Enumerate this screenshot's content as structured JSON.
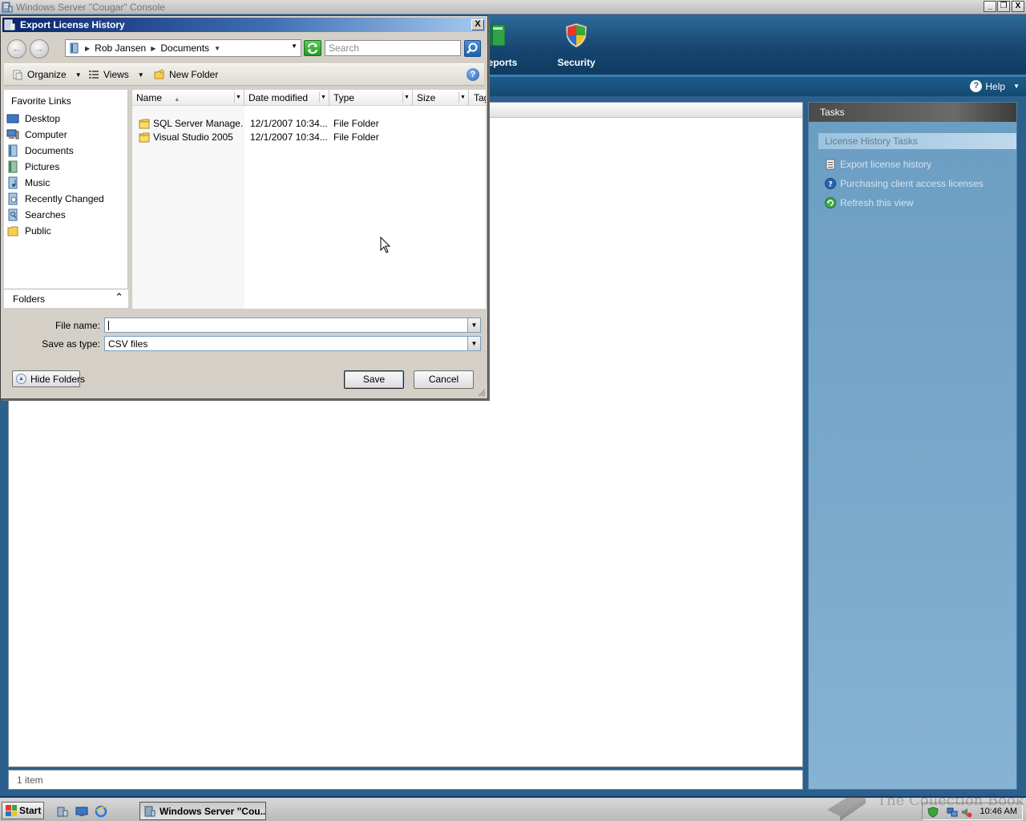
{
  "console": {
    "title": "Windows Server \"Cougar\" Console",
    "nav_tabs": [
      {
        "label": "eports",
        "icon": "reports-book-icon"
      },
      {
        "label": "Security",
        "icon": "security-shield-icon"
      }
    ],
    "help_label": "Help",
    "status_text": "1 item",
    "tasks": {
      "header": "Tasks",
      "section_title": "License History Tasks",
      "links": [
        {
          "label": "Export license history",
          "icon": "document-list-icon"
        },
        {
          "label": "Purchasing client access licenses",
          "icon": "help-circle-icon"
        },
        {
          "label": "Refresh this view",
          "icon": "refresh-icon"
        }
      ]
    }
  },
  "dialog": {
    "title": "Export License History",
    "close_glyph": "X",
    "breadcrumbs": [
      "Rob Jansen",
      "Documents"
    ],
    "search_placeholder": "Search",
    "toolbar": {
      "organize": "Organize",
      "views": "Views",
      "new_folder": "New Folder"
    },
    "favorites": {
      "title": "Favorite Links",
      "items": [
        {
          "label": "Desktop",
          "icon": "desktop-icon"
        },
        {
          "label": "Computer",
          "icon": "computer-icon"
        },
        {
          "label": "Documents",
          "icon": "documents-icon"
        },
        {
          "label": "Pictures",
          "icon": "pictures-icon"
        },
        {
          "label": "Music",
          "icon": "music-icon"
        },
        {
          "label": "Recently Changed",
          "icon": "recently-changed-icon"
        },
        {
          "label": "Searches",
          "icon": "searches-icon"
        },
        {
          "label": "Public",
          "icon": "public-folder-icon"
        }
      ]
    },
    "folders_label": "Folders",
    "columns": [
      "Name",
      "Date modified",
      "Type",
      "Size",
      "Tag"
    ],
    "files": [
      {
        "name": "SQL Server Manage...",
        "date": "12/1/2007 10:34...",
        "type": "File Folder"
      },
      {
        "name": "Visual Studio 2005",
        "date": "12/1/2007 10:34...",
        "type": "File Folder"
      }
    ],
    "file_name_label": "File name:",
    "file_name_value": "",
    "save_type_label": "Save as type:",
    "save_type_value": "CSV files",
    "hide_folders": "Hide Folders",
    "save": "Save",
    "cancel": "Cancel"
  },
  "taskbar": {
    "start": "Start",
    "task_button": "Windows Server \"Cou...",
    "clock": "10:46 AM",
    "watermark": "The Collection Book"
  },
  "colors": {
    "dialog_title_start": "#0a246a",
    "banner": "#17456f",
    "tasks_pane": "#7aa9cc"
  }
}
